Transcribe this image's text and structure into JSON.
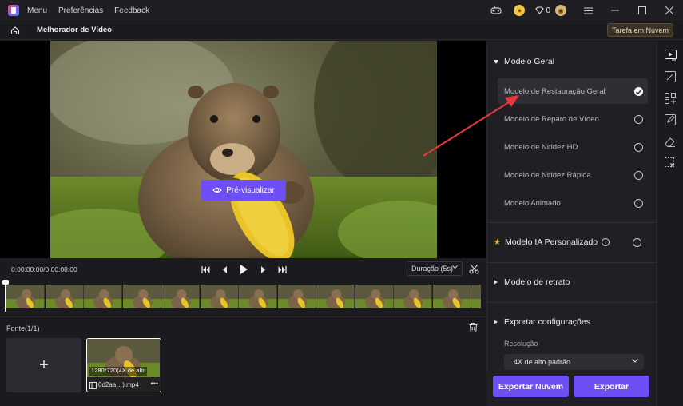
{
  "titlebar": {
    "menu": [
      "Menu",
      "Preferências",
      "Feedback"
    ],
    "gem_count": "0"
  },
  "navbar": {
    "page_title": "Melhorador de Vídeo",
    "cloud_task": "Tarefa em Nuvem"
  },
  "preview": {
    "button_label": "Pré-visualizar"
  },
  "playback": {
    "time": "0:00:00:00/0:00:08:00",
    "duration_label": "Duração (5s)"
  },
  "source": {
    "label": "Fonte(1/1)",
    "clip": {
      "resolution": "1280*720(4X de alto",
      "name": "0d2aa…).mp4"
    }
  },
  "panel": {
    "general_title": "Modelo Geral",
    "models": [
      {
        "label": "Modelo de Restauração Geral",
        "selected": true
      },
      {
        "label": "Modelo de Reparo de Vídeo",
        "selected": false
      },
      {
        "label": "Modelo de Nitidez HD",
        "selected": false
      },
      {
        "label": "Modelo de Nitidez Rápida",
        "selected": false
      },
      {
        "label": "Modelo Animado",
        "selected": false
      }
    ],
    "custom_title": "Modelo IA Personalizado",
    "portrait_title": "Modelo de retrato",
    "export_title": "Exportar configurações",
    "resolution_label": "Resolução",
    "resolution_value": "4X de alto padrão"
  },
  "export": {
    "cloud_label": "Exportar Nuvem",
    "export_label": "Exportar"
  },
  "colors": {
    "accent": "#6e4ff6",
    "annotation_arrow": "#e5383b",
    "star": "#f3b536"
  }
}
